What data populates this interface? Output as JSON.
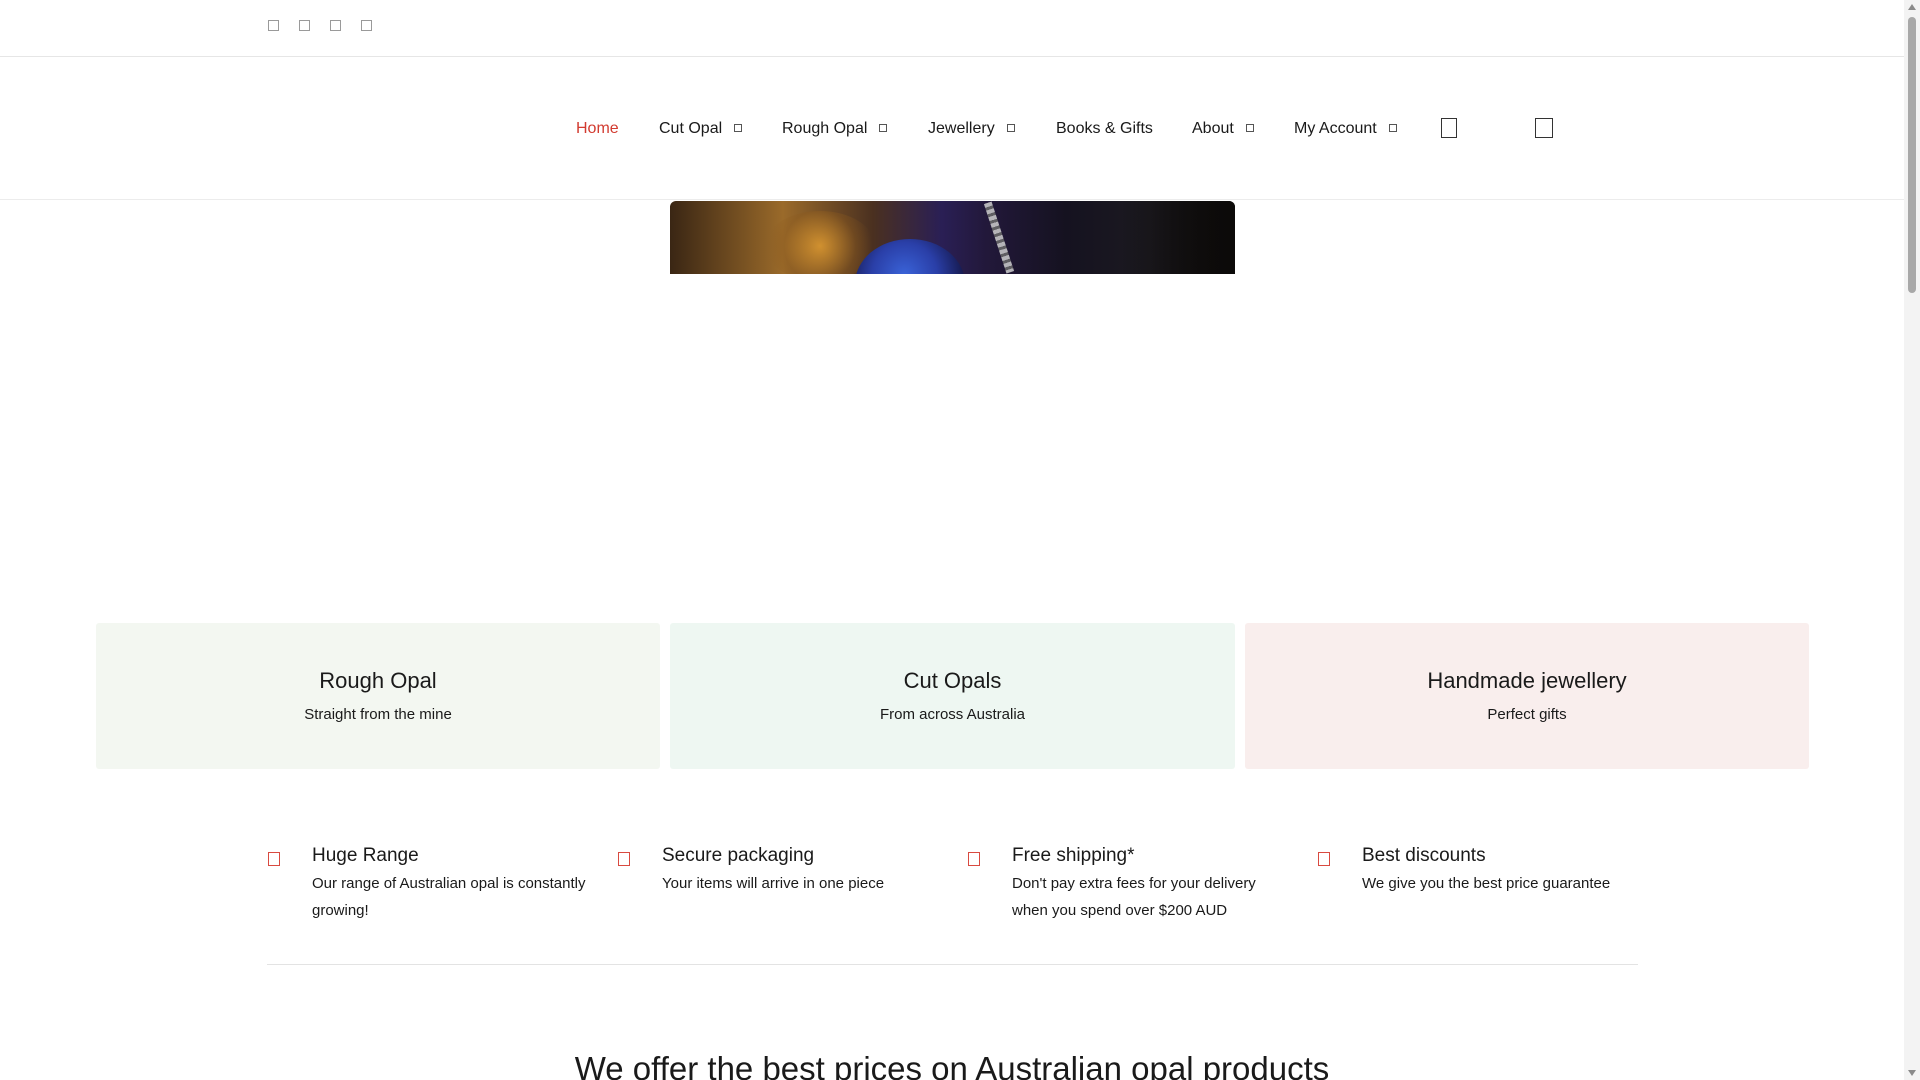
{
  "topbar": {
    "social_icons": [
      "facebook-icon",
      "instagram-icon",
      "twitter-icon",
      "youtube-icon"
    ]
  },
  "nav": {
    "items": [
      {
        "label": "Home",
        "active": true,
        "dropdown": false
      },
      {
        "label": "Cut Opal",
        "active": false,
        "dropdown": true
      },
      {
        "label": "Rough Opal",
        "active": false,
        "dropdown": true
      },
      {
        "label": "Jewellery",
        "active": false,
        "dropdown": true
      },
      {
        "label": "Books & Gifts",
        "active": false,
        "dropdown": false
      },
      {
        "label": "About",
        "active": false,
        "dropdown": true
      },
      {
        "label": "My Account",
        "active": false,
        "dropdown": true
      }
    ],
    "icons": [
      "search-icon",
      "cart-icon"
    ],
    "active_color": "#d23b30"
  },
  "categories": [
    {
      "title": "Rough Opal",
      "subtitle": "Straight from the mine",
      "bg": "#f3f7f1"
    },
    {
      "title": "Cut Opals",
      "subtitle": "From across Australia",
      "bg": "#eef7f2"
    },
    {
      "title": "Handmade jewellery",
      "subtitle": "Perfect gifts",
      "bg": "#f9eeed"
    }
  ],
  "features": [
    {
      "title": "Huge Range",
      "text": "Our range of Australian opal is constantly growing!"
    },
    {
      "title": "Secure packaging",
      "text": "Your items will arrive in one piece"
    },
    {
      "title": "Free shipping*",
      "text": "Don't pay extra fees for your delivery when you spend over $200 AUD"
    },
    {
      "title": "Best discounts",
      "text": "We give you the best price guarantee"
    }
  ],
  "section": {
    "heading": "We offer the best prices on Australian opal products"
  },
  "colors": {
    "accent": "#d94a40",
    "text": "#1a1a1a"
  }
}
